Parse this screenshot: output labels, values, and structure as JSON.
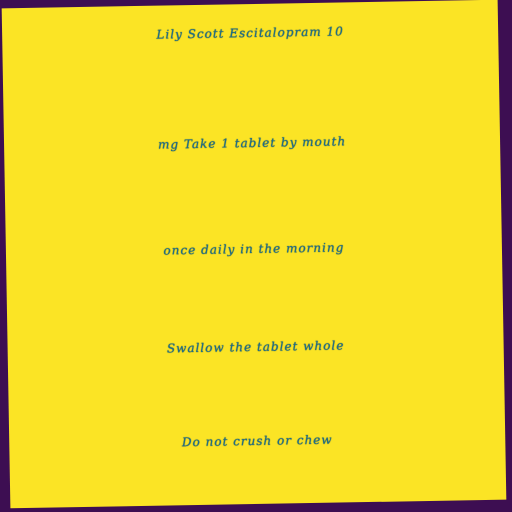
{
  "label": {
    "lines": [
      "Lily Scott Escitalopram 10",
      "mg Take 1 tablet by mouth",
      "once daily in the morning",
      "Swallow the tablet whole",
      "Do not crush or chew"
    ]
  },
  "colors": {
    "background": "#3d0e52",
    "paper": "#fbe425",
    "ink": "#1d6e8a"
  }
}
